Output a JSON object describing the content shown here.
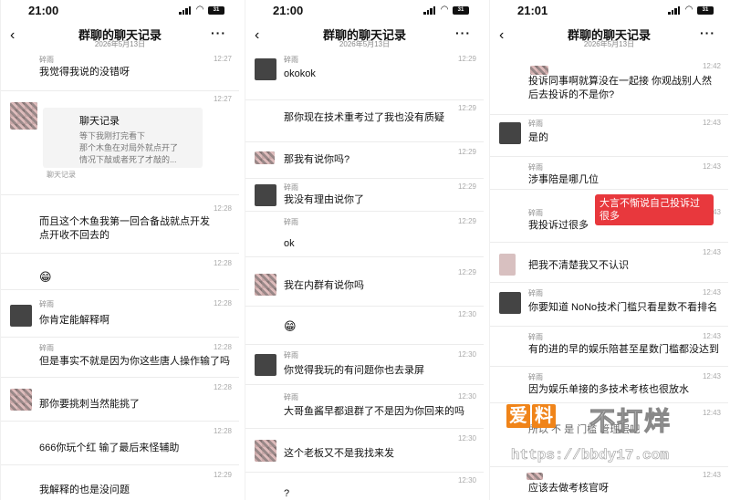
{
  "panels": [
    {
      "status": {
        "time": "21:00",
        "battery": "31"
      },
      "nav": {
        "title": "群聊的聊天记录",
        "date": "2026年5月13日"
      },
      "messages": [
        {
          "name": "碎雨",
          "time": "12:27",
          "text": "我觉得我说的没错呀"
        },
        {
          "name": "",
          "time": "12:27",
          "card_title": "聊天记录",
          "card_lines": [
            "等下我刚打完看下",
            "那个木鱼在对局外就点开了",
            "情况下敲或者死了才敲的..."
          ],
          "card_footer": "聊天记录"
        },
        {
          "name": "",
          "time": "12:28",
          "text": "而且这个木鱼我第一回合备战就点开发 点开收不回去的"
        },
        {
          "name": "",
          "time": "12:28",
          "emoji": "😁"
        },
        {
          "name": "碎雨",
          "time": "12:28",
          "text": "你肯定能解释啊"
        },
        {
          "name": "碎雨",
          "time": "12:28",
          "text": "但是事实不就是因为你这些唐人操作输了吗"
        },
        {
          "name": "",
          "time": "12:28",
          "text": "那你要挑刺当然能挑了"
        },
        {
          "name": "",
          "time": "12:28",
          "text": "666你玩个红 输了最后来怪辅助"
        },
        {
          "name": "",
          "time": "12:29",
          "text": "我解释的也是没问题"
        }
      ]
    },
    {
      "status": {
        "time": "21:00",
        "battery": "31"
      },
      "nav": {
        "title": "群聊的聊天记录",
        "date": "2026年5月13日"
      },
      "messages": [
        {
          "name": "碎雨",
          "time": "12:29",
          "text": "okokok"
        },
        {
          "name": "",
          "time": "12:29",
          "text": "那你现在技术重考过了我也没有质疑"
        },
        {
          "name": "",
          "time": "12:29",
          "text": "那我有说你吗?"
        },
        {
          "name": "碎雨",
          "time": "12:29",
          "text": "我没有理由说你了"
        },
        {
          "name": "碎雨",
          "time": "12:29",
          "text": "ok"
        },
        {
          "name": "",
          "time": "12:29",
          "text": "我在内群有说你吗"
        },
        {
          "name": "",
          "time": "12:30",
          "emoji": "😁"
        },
        {
          "name": "碎雨",
          "time": "12:30",
          "text": "你觉得我玩的有问题你也去录屏"
        },
        {
          "name": "碎雨",
          "time": "12:30",
          "text": "大哥鱼酱早都退群了不是因为你回来的吗"
        },
        {
          "name": "",
          "time": "12:30",
          "text": "这个老板又不是我找来发"
        },
        {
          "name": "",
          "time": "12:30",
          "text": "?"
        }
      ]
    },
    {
      "status": {
        "time": "21:01",
        "battery": "31"
      },
      "nav": {
        "title": "群聊的聊天记录",
        "date": "2026年5月13日"
      },
      "messages": [
        {
          "name": "",
          "time": "12:42",
          "text": "投诉同事啊就算没在一起接 你观战别人然后去投诉的不是你?"
        },
        {
          "name": "碎雨",
          "time": "12:43",
          "text": "是的"
        },
        {
          "name": "碎雨",
          "time": "12:43",
          "text": "涉事陪是哪几位"
        },
        {
          "name": "碎雨",
          "time": "12:43",
          "text": "我投诉过很多"
        },
        {
          "name": "",
          "time": "12:43",
          "text": "把我不清楚我又不认识"
        },
        {
          "name": "碎雨",
          "time": "12:43",
          "text": "你要知道 NoNo技术门槛只看星数不看排名"
        },
        {
          "name": "碎雨",
          "time": "12:43",
          "text": "有的进的早的娱乐陪甚至星数门槛都没达到"
        },
        {
          "name": "碎雨",
          "time": "12:43",
          "text": "因为娱乐单接的多技术考核也很放水"
        },
        {
          "name": "",
          "time": "12:43",
          "text": "所以  不   是   门槛   管理层吧"
        },
        {
          "name": "",
          "time": "12:43",
          "text": "应该去做考核官呀"
        }
      ],
      "annotation": "大言不惭说自己投诉过很多"
    }
  ],
  "watermark": {
    "logo": [
      "爱",
      "料"
    ],
    "brand": "不打烊",
    "url": "https://bbdy17.com"
  }
}
